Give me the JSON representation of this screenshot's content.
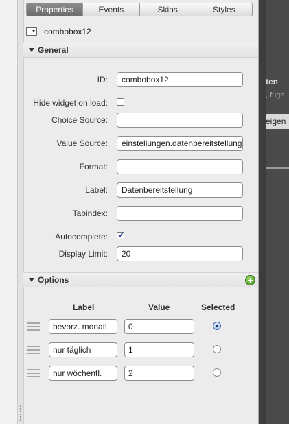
{
  "tabs": [
    {
      "label": "Properties",
      "active": true
    },
    {
      "label": "Events",
      "active": false
    },
    {
      "label": "Skins",
      "active": false
    },
    {
      "label": "Styles",
      "active": false
    }
  ],
  "widget": {
    "icon": "combobox-icon",
    "name": "combobox12"
  },
  "general": {
    "title": "General",
    "id_label": "ID:",
    "id_value": "combobox12",
    "hide_label": "Hide widget on load:",
    "choice_label": "Choice Source:",
    "choice_value": "",
    "value_label": "Value Source:",
    "value_value": "einstellungen.datenbereitstellung",
    "format_label": "Format:",
    "format_value": "",
    "label_label": "Label:",
    "label_value": "Datenbereitstellung",
    "tabindex_label": "Tabindex:",
    "tabindex_value": "",
    "autocomplete_label": "Autocomplete:",
    "display_limit_label": "Display Limit:",
    "display_limit_value": "20"
  },
  "options": {
    "title": "Options",
    "col_label": "Label",
    "col_value": "Value",
    "col_selected": "Selected",
    "rows": [
      {
        "label": "bevorz. monatl.",
        "value": "0",
        "selected": true
      },
      {
        "label": "nur täglich",
        "value": "1",
        "selected": false
      },
      {
        "label": "nur wöchentl.",
        "value": "2",
        "selected": false
      }
    ]
  },
  "right_panel": {
    "text1": "ten",
    "text2": ", füge",
    "text3": "eigen"
  },
  "colors": {
    "accent": "#1d3f8a",
    "add": "#3f8f1f"
  }
}
